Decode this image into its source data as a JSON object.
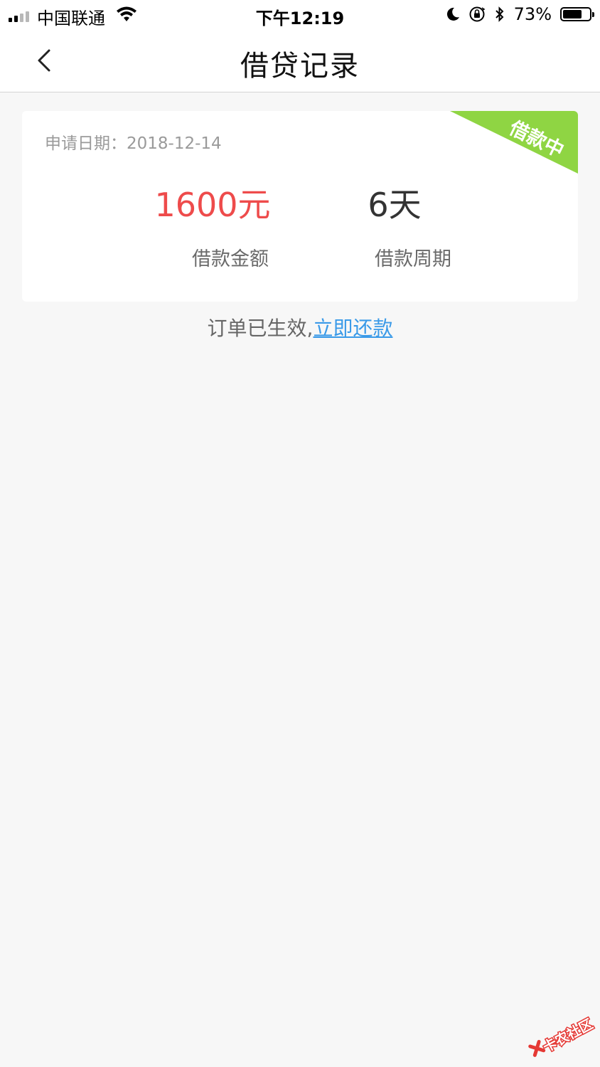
{
  "status_bar": {
    "carrier": "中国联通",
    "time": "下午12:19",
    "battery": "73%",
    "battery_level": 0.73,
    "icons": [
      "signal-icon",
      "wifi-icon",
      "moon-icon",
      "orientation-lock-icon",
      "bluetooth-icon",
      "battery-icon"
    ]
  },
  "nav": {
    "title": "借贷记录",
    "back_icon": "chevron-left-icon"
  },
  "loan_card": {
    "apply_date": "申请日期：2018-12-14",
    "status": "借款中",
    "status_color": "#8fd543",
    "amount_value": "1600元",
    "amount_label": "借款金额",
    "amount_color": "#ee4b4b",
    "period_value": "6天",
    "period_label": "借款周期"
  },
  "notice": {
    "text": "订单已生效,",
    "link": "立即还款",
    "link_color": "#3a9ae8"
  },
  "watermark": {
    "text": "卡农社区"
  }
}
